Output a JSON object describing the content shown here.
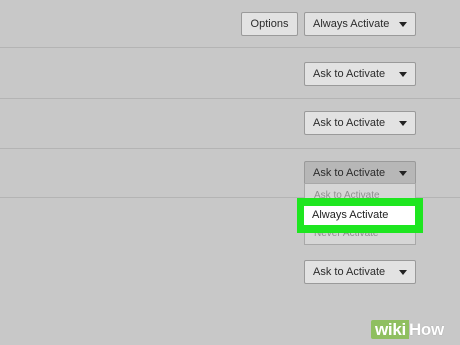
{
  "rows": [
    {
      "options_label": "Options",
      "select_value": "Always Activate"
    },
    {
      "select_value": "Ask to Activate"
    },
    {
      "select_value": "Ask to Activate"
    },
    {
      "select_value": "Ask to Activate"
    },
    {
      "select_value": "Ask to Activate"
    }
  ],
  "dropdown": {
    "options": [
      "Ask to Activate",
      "Always Activate",
      "Never Activate"
    ],
    "highlighted": "Always Activate"
  },
  "watermark": {
    "part1": "wiki",
    "part2": "How"
  },
  "colors": {
    "background": "#c8c8c8",
    "highlight": "#1ee620",
    "watermark_green": "#8fbf60"
  },
  "icons": [
    "chevron-down-icon"
  ]
}
